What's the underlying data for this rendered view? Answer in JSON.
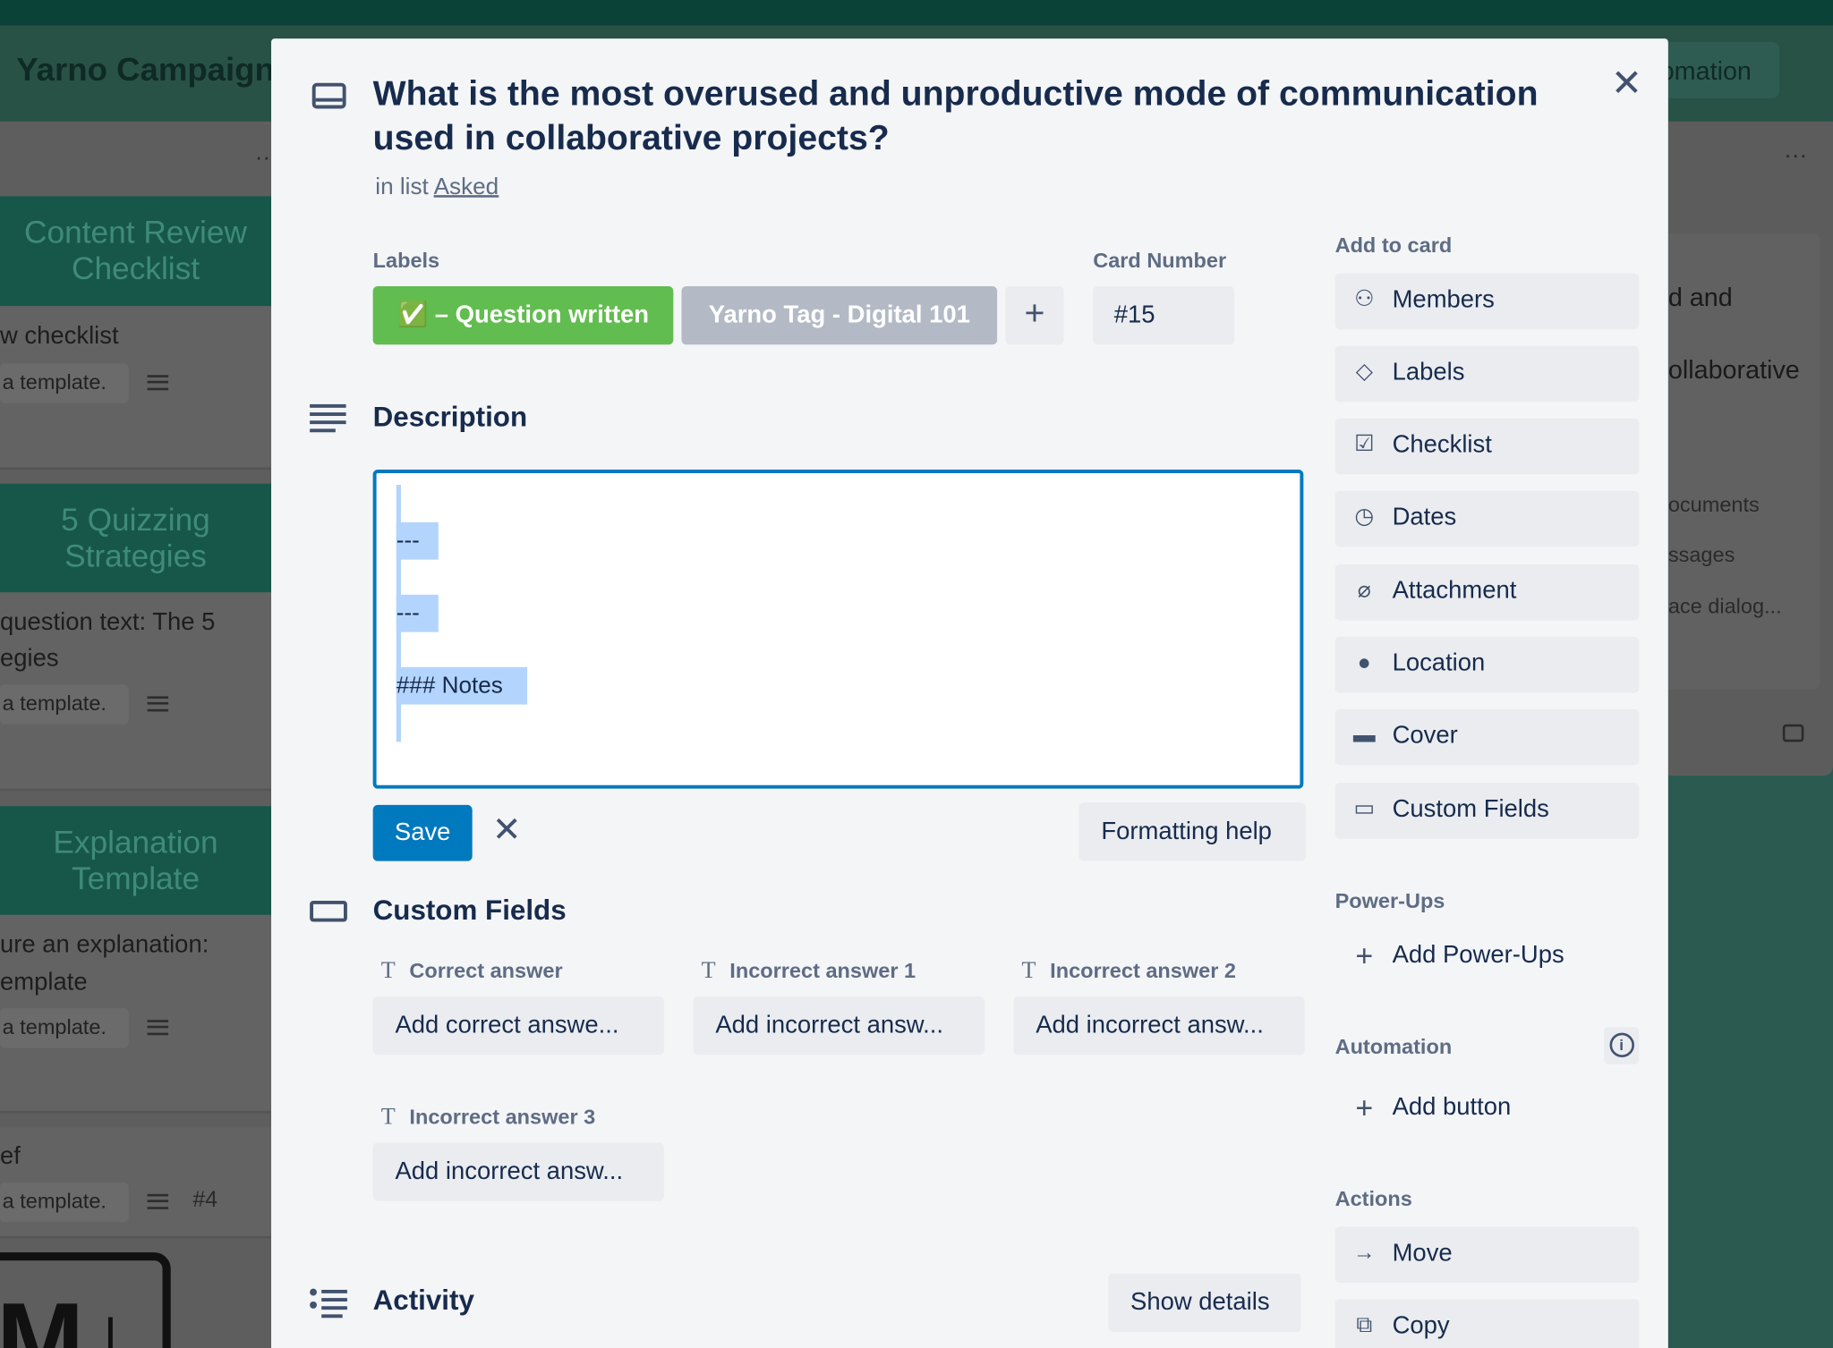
{
  "board": {
    "title": "Yarno Campaign",
    "header_button": "omation",
    "left_cards": [
      {
        "cover": "Content Review Checklist",
        "text": [
          "w checklist"
        ],
        "badge": "a template."
      },
      {
        "cover": "5 Quizzing Strategies",
        "text": [
          "question text: The 5",
          "egies"
        ],
        "badge": "a template."
      },
      {
        "cover": "Explanation Template",
        "text": [
          "ure an explanation:",
          "emplate"
        ],
        "badge": "a template."
      },
      {
        "text": [
          "ef"
        ],
        "badge": "a template.",
        "number": "#4"
      }
    ],
    "right_card": {
      "lines": [
        "d and",
        "ollaborative"
      ],
      "items": [
        "ocuments",
        "ssages",
        "ace dialog..."
      ]
    }
  },
  "card": {
    "title": "What is the most overused and unproductive mode of communication used in collaborative projects?",
    "in_list_prefix": "in list",
    "list_name": "Asked",
    "labels_heading": "Labels",
    "labels": [
      {
        "text": "✅ – Question written",
        "color": "#61bd4f"
      },
      {
        "text": "Yarno Tag - Digital 101",
        "color": "#b3bac5"
      }
    ],
    "card_number_heading": "Card Number",
    "card_number": "#15",
    "description_heading": "Description",
    "description_lines": [
      "---",
      "---",
      "### Notes"
    ],
    "save_label": "Save",
    "formatting_help": "Formatting help",
    "custom_fields_heading": "Custom Fields",
    "custom_fields": [
      {
        "label": "Correct answer",
        "placeholder": "Add correct answe..."
      },
      {
        "label": "Incorrect answer 1",
        "placeholder": "Add incorrect answ..."
      },
      {
        "label": "Incorrect answer 2",
        "placeholder": "Add incorrect answ..."
      },
      {
        "label": "Incorrect answer 3",
        "placeholder": "Add incorrect answ..."
      }
    ],
    "activity_heading": "Activity",
    "show_details": "Show details"
  },
  "sidebar": {
    "add_to_card": "Add to card",
    "items": [
      "Members",
      "Labels",
      "Checklist",
      "Dates",
      "Attachment",
      "Location",
      "Cover",
      "Custom Fields"
    ],
    "powerups_heading": "Power-Ups",
    "add_powerups": "Add Power-Ups",
    "automation_heading": "Automation",
    "add_button": "Add button",
    "actions_heading": "Actions",
    "actions": [
      "Move",
      "Copy"
    ]
  },
  "colors": {
    "primary": "#0079bf",
    "label_green": "#61bd4f",
    "label_grey": "#b3bac5",
    "text": "#172b4d"
  }
}
